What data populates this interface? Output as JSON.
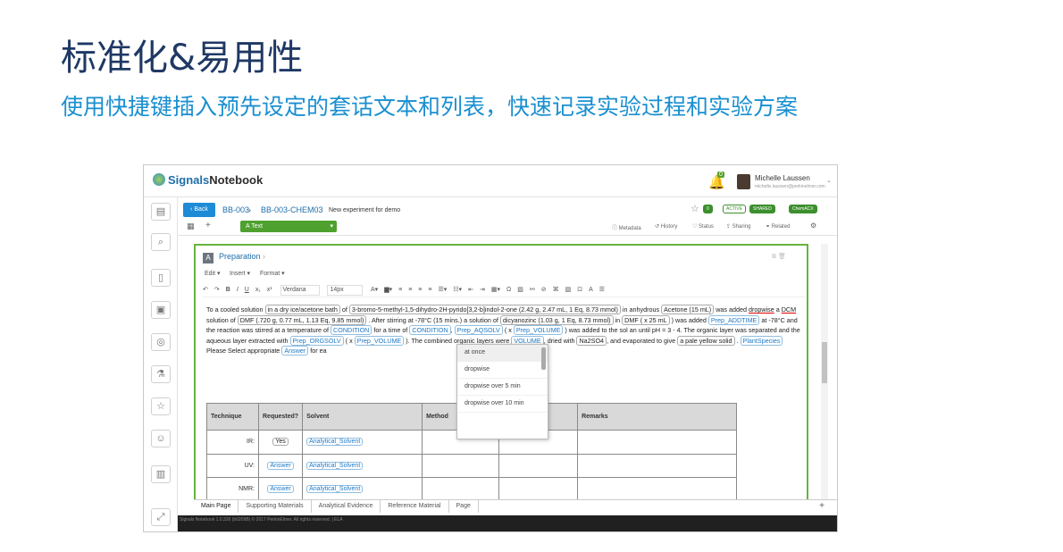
{
  "slide": {
    "title": "标准化&易用性",
    "subtitle": "使用快捷键插入预先设定的套话文本和列表，快速记录实验过程和实验方案"
  },
  "app": {
    "logo_prefix": "Signals",
    "logo_suffix": "Notebook",
    "notification_count": "0",
    "user_name": "Michelle Laussen",
    "user_email": "michelle.laussen@perkinelmer.com"
  },
  "breadcrumb": {
    "back": "Back",
    "item1": "BB-003",
    "item2": "BB-003-CHEM03",
    "description": "New experiment for demo"
  },
  "badges": [
    "0",
    "ACTIVE",
    "SHARED",
    "ChemACX"
  ],
  "toolbar": {
    "text_button": "Text",
    "metadata": "Metadata",
    "history": "History",
    "status": "Status",
    "sharing": "Sharing",
    "related": "Related"
  },
  "section": {
    "title": "Preparation",
    "menu_edit": "Edit",
    "menu_insert": "Insert",
    "menu_format": "Format",
    "font": "Verdana",
    "size": "14px"
  },
  "text": {
    "p1": "To a cooled solution",
    "t_ice": "in  a dry ice/acetone bath",
    "p2": "of",
    "t_sm": "3-bromo-5-methyl-1,5-dihydro-2H-pyrido[3,2-b]indol-2-one (2.42 g, 2.47 mL, 1 Eq, 8.73 mmol)",
    "p3": "in anhydrous",
    "t_acetone": "Acetone (15 mL)",
    "p4": "was added",
    "w_dropwise": "dropwise",
    "p5": "a",
    "w_dcm": "DCM",
    "p6": "solution of",
    "t_dmf": "DMF (.720 g, 0.77 mL, 1.13 Eq, 9.85 mmol)",
    "p7": ". After stirring at -78°C (15 mins.) a solution of",
    "t_dicy": "dicyanozinc (1.03 g, 1 Eq, 8.73 mmol)",
    "p8": "in",
    "t_dmf2": "DMF  ( x  25 mL",
    "p9": ") was added",
    "k_addtime": "Prep_ADDTIME",
    "p10": "at -78°C and the reaction was stirred at a temperature of",
    "k_condition": "CONDITION",
    "p11": "for a time of",
    "k_condition2": "CONDITION",
    "k_aqsolv": "Prep_AQSOLV",
    "p12": "( x",
    "k_volume": "Prep_VOLUME",
    "p13": ") was added to the sol",
    "p13b": "an until pH = 3 - 4. The organic layer was separated and the aqueous layer extracted with",
    "k_orgsolv": "Prep_ORGSOLV",
    "p14": "( x",
    "k_volume2": "Prep_VOLUME",
    "p15": "). The combined organic layers were",
    "k_volume3": "VOLUME",
    "p16": ", dried with",
    "t_na2so4": "Na2SO4",
    "p17": ", and evaporated to give",
    "t_solid": "a pale yellow solid",
    "p18": ".",
    "k_plant": "PlantSpecies",
    "p19": "Please Select appropriate",
    "k_answer": "Answer",
    "p20": "for ea"
  },
  "dropdown": {
    "items": [
      "at once",
      "dropwise",
      "dropwise over 5 min",
      "dropwise over 10 min"
    ]
  },
  "table": {
    "headers": [
      "Technique",
      "Requested?",
      "Solvent",
      "Method",
      "",
      "Remarks"
    ],
    "rows": [
      {
        "technique": "IR:",
        "requested": "Yes",
        "solvent": "Analytical_Solvent"
      },
      {
        "technique": "UV:",
        "requested": "Answer",
        "solvent": "Analytical_Solvent"
      },
      {
        "technique": "NMR:",
        "requested": "Answer",
        "solvent": "Analytical_Solvent"
      }
    ]
  },
  "tabs": [
    "Main Page",
    "Supporting Materials",
    "Analytical Evidence",
    "Reference Material",
    "Page"
  ],
  "footer": "Signals Notebook 1.0.326 (b0209B) © 2017 PerkinElmer. All rights reserved. | ELA"
}
